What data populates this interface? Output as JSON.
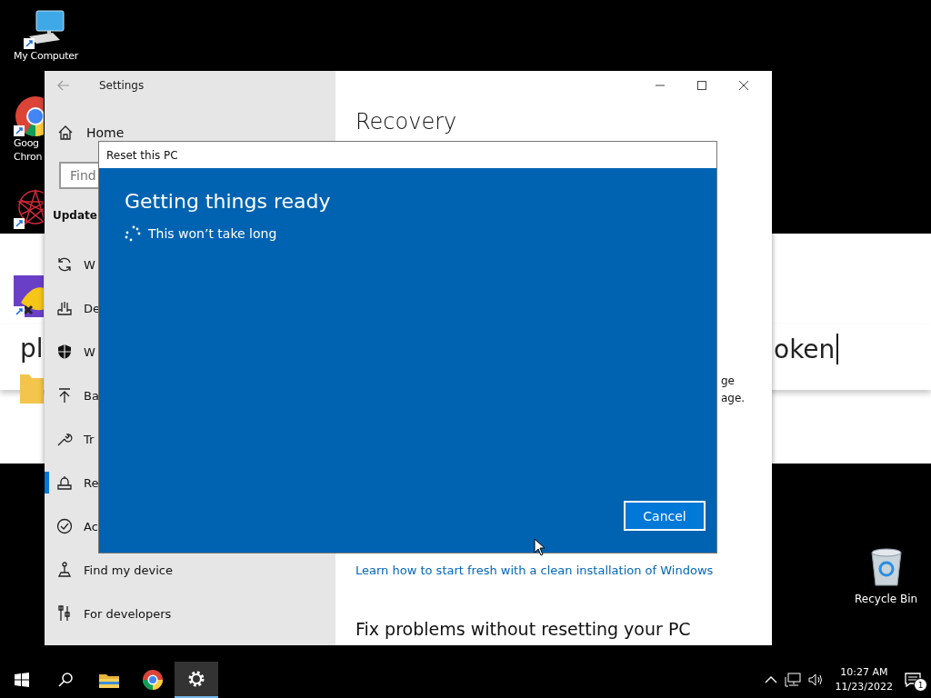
{
  "desktop": {
    "icons": [
      {
        "kind": "computer",
        "lines": [
          "My Computer"
        ]
      },
      {
        "kind": "browser",
        "lines": [
          "Goog",
          "Chron"
        ]
      },
      {
        "kind": "star"
      },
      {
        "kind": "game"
      }
    ],
    "recycle_bin": {
      "label": "Recycle Bin"
    },
    "background_window": {
      "text_left": "pl",
      "text_right": "oken"
    }
  },
  "settings_window": {
    "title": "Settings",
    "sidebar": {
      "home": "Home",
      "search": {
        "placeholder": "Find"
      },
      "section": "Update",
      "items": [
        {
          "label": "W",
          "selected": false
        },
        {
          "label": "De",
          "selected": false
        },
        {
          "label": "W",
          "selected": false
        },
        {
          "label": "Ba",
          "selected": false
        },
        {
          "label": "Tr",
          "selected": false
        },
        {
          "label": "Re",
          "selected": true
        },
        {
          "label": "Ac",
          "selected": false
        },
        {
          "label": "Find my device",
          "selected": false
        },
        {
          "label": "For developers",
          "selected": false
        }
      ]
    },
    "content": {
      "heading": "Recovery",
      "fragment_lines": [
        "ge",
        "age."
      ],
      "link": "Learn how to start fresh with a clean installation of Windows",
      "section_heading": "Fix problems without resetting your PC"
    }
  },
  "dialog": {
    "title": "Reset this PC",
    "heading": "Getting things ready",
    "status": "This won’t take long",
    "button": "Cancel"
  },
  "taskbar": {
    "items": [
      {
        "selected": false
      },
      {
        "selected": false
      },
      {
        "selected": false
      },
      {
        "selected": false
      },
      {
        "selected": true
      }
    ],
    "time": "10:27 AM",
    "date": "11/23/2022",
    "notification_count": "1"
  }
}
